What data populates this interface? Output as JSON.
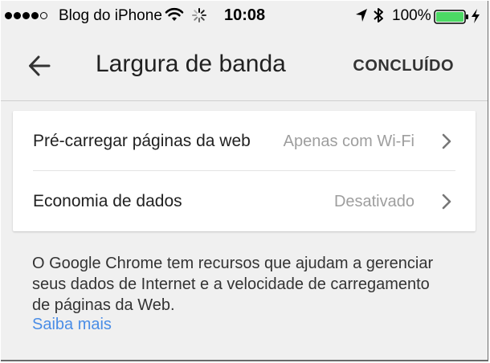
{
  "status_bar": {
    "carrier": "Blog do iPhone",
    "time": "10:08",
    "battery_percent": "100%",
    "battery_color": "#4cd964",
    "signal_bars_filled": 4,
    "signal_bars_total": 5,
    "icons": [
      "signal-dots-icon",
      "wifi-icon",
      "activity-spinner-icon",
      "location-arrow-icon",
      "bluetooth-icon",
      "battery-icon",
      "charging-bolt-icon"
    ]
  },
  "appbar": {
    "title": "Largura de banda",
    "done_label": "CONCLUÍDO",
    "back_icon": "arrow-left-icon"
  },
  "settings": [
    {
      "label": "Pré-carregar páginas da web",
      "value": "Apenas com Wi-Fi"
    },
    {
      "label": "Economia de dados",
      "value": "Desativado"
    }
  ],
  "description": {
    "text": "O Google Chrome tem recursos que ajudam a gerenciar seus dados de Internet e a velocidade de carregamento de páginas da Web.",
    "link": "Saiba mais",
    "link_color": "#4a8de6"
  }
}
